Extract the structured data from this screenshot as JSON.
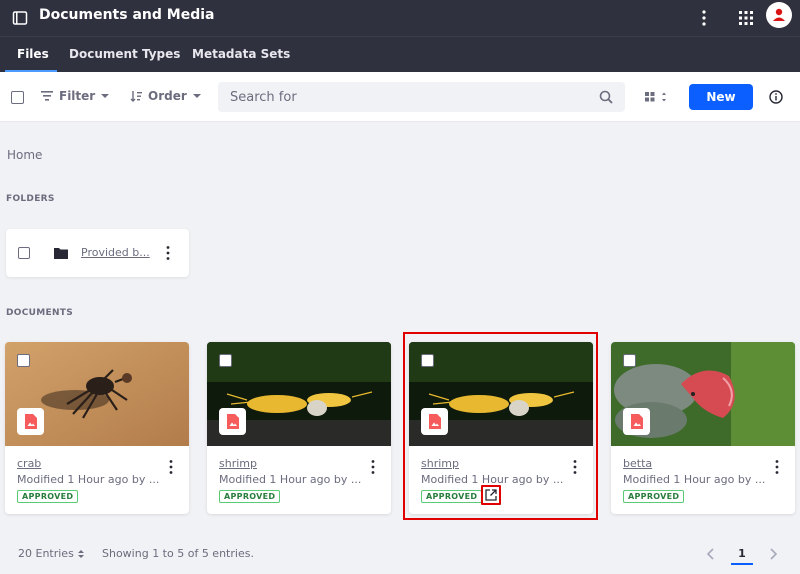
{
  "header": {
    "title": "Documents and Media"
  },
  "tabs": [
    {
      "label": "Files",
      "active": true
    },
    {
      "label": "Document Types",
      "active": false
    },
    {
      "label": "Metadata Sets",
      "active": false
    }
  ],
  "toolbar": {
    "filter_label": "Filter",
    "order_label": "Order",
    "search_placeholder": "Search for",
    "new_label": "New"
  },
  "breadcrumb": "Home",
  "sections": {
    "folders": "FOLDERS",
    "documents": "DOCUMENTS"
  },
  "folders": [
    {
      "name": "Provided b..."
    }
  ],
  "documents": [
    {
      "title": "crab",
      "modified": "Modified 1 Hour ago by ...",
      "status": "APPROVED"
    },
    {
      "title": "shrimp",
      "modified": "Modified 1 Hour ago by ...",
      "status": "APPROVED"
    },
    {
      "title": "shrimp",
      "modified": "Modified 1 Hour ago by ...",
      "status": "APPROVED"
    },
    {
      "title": "betta",
      "modified": "Modified 1 Hour ago by ...",
      "status": "APPROVED"
    }
  ],
  "footer": {
    "entries_label": "20 Entries",
    "showing": "Showing 1 to 5 of 5 entries.",
    "current_page": "1"
  },
  "colors": {
    "header_bg": "#30313f",
    "primary": "#0b5fff",
    "approved": "#287d3c",
    "highlight": "#e00000"
  }
}
